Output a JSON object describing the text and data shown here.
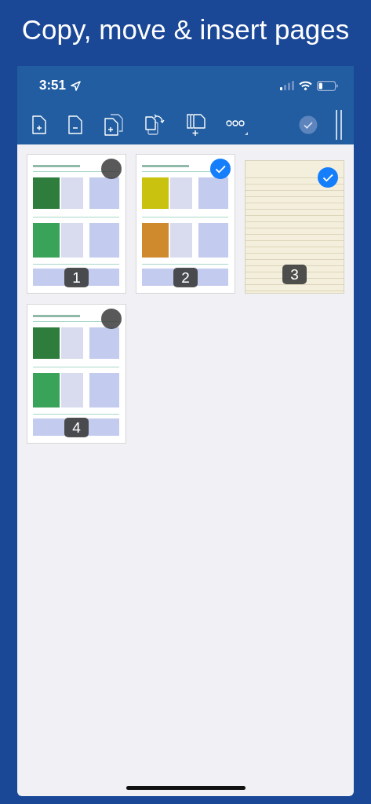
{
  "headline": "Copy, move & insert pages",
  "status_bar": {
    "time": "3:51"
  },
  "pages": [
    {
      "number": "1",
      "kind": "document",
      "selected": false
    },
    {
      "number": "2",
      "kind": "document",
      "selected": true
    },
    {
      "number": "3",
      "kind": "lined",
      "selected": true
    },
    {
      "number": "4",
      "kind": "document",
      "selected": false
    }
  ]
}
